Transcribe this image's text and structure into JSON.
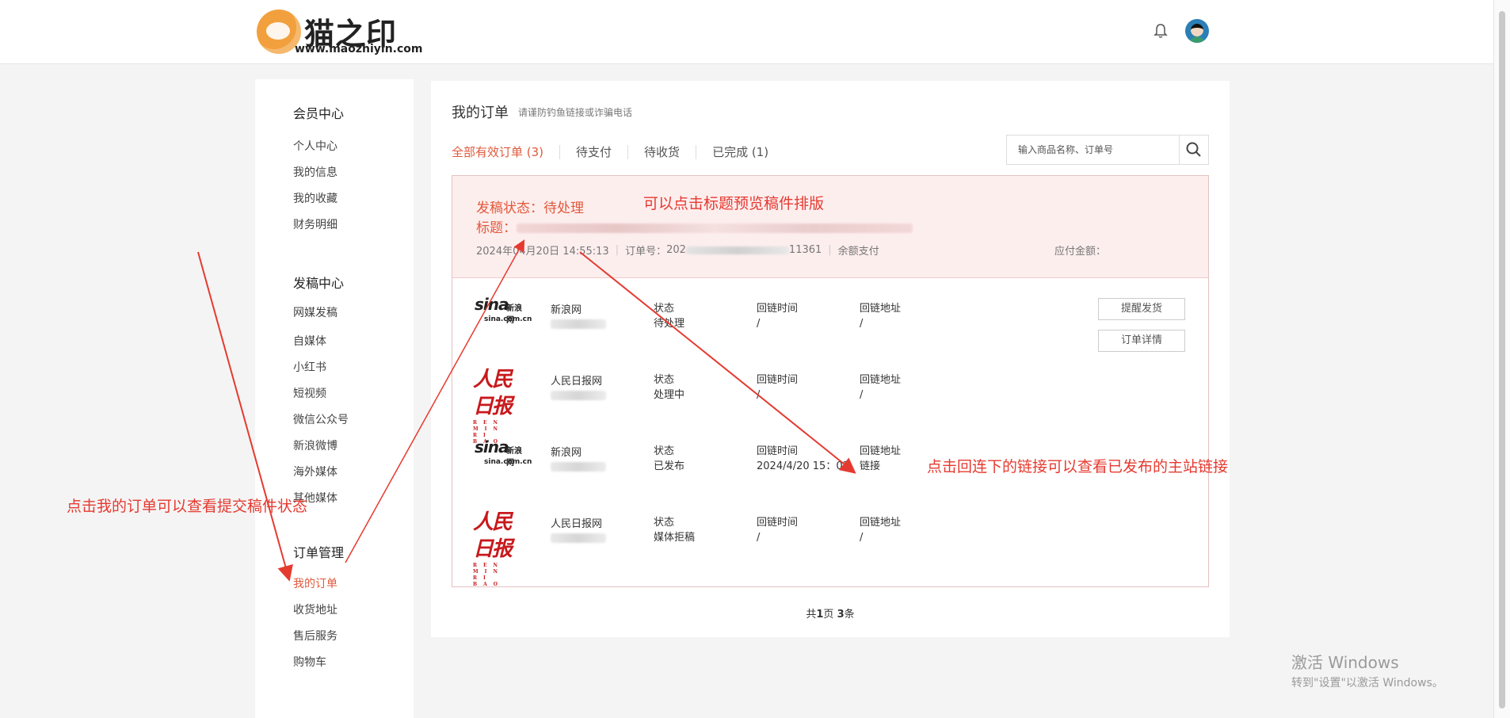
{
  "header": {
    "logo_name": "猫之印",
    "logo_url": "www.maozhiyin.com"
  },
  "sidebar": {
    "sections": [
      {
        "title": "会员中心",
        "items": [
          "个人中心",
          "我的信息",
          "我的收藏",
          "财务明细"
        ]
      },
      {
        "title": "发稿中心",
        "items": [
          "网媒发稿",
          "自媒体",
          "小红书",
          "短视频",
          "微信公众号",
          "新浪微博",
          "海外媒体",
          "其他媒体"
        ]
      },
      {
        "title": "订单管理",
        "items": [
          "我的订单",
          "收货地址",
          "售后服务",
          "购物车"
        ]
      }
    ],
    "active_item": "我的订单"
  },
  "main": {
    "title": "我的订单",
    "notice": "请谨防钓鱼链接或诈骗电话",
    "tabs": [
      "全部有效订单 (3)",
      "待支付",
      "待收货",
      "已完成 (1)"
    ],
    "search_placeholder": "输入商品名称、订单号",
    "order": {
      "status_line": "发稿状态：待处理",
      "title_label": "标题：",
      "date": "2024年04月20日 14:55:13",
      "order_no_label": "订单号：",
      "order_no_prefix": "202",
      "order_no_suffix": "11361",
      "payment": "余额支付",
      "payable_label": "应付金额："
    },
    "columns": {
      "status": "状态",
      "backlink_time": "回链时间",
      "backlink_url": "回链地址"
    },
    "rows": [
      {
        "logo": "sina",
        "media": "新浪网",
        "status": "待处理",
        "time": "/",
        "url": "/"
      },
      {
        "logo": "rmrb",
        "media": "人民日报网",
        "status": "处理中",
        "time": "/",
        "url": "/"
      },
      {
        "logo": "sina",
        "media": "新浪网",
        "status": "已发布",
        "time": "2024/4/20 15：02",
        "url": "链接"
      },
      {
        "logo": "rmrb",
        "media": "人民日报网",
        "status": "媒体拒稿",
        "time": "/",
        "url": "/"
      }
    ],
    "buttons": {
      "remind": "提醒发货",
      "detail": "订单详情"
    },
    "pager": {
      "prefix": "共",
      "pages": "1",
      "mid": "页 ",
      "count": "3",
      "suffix": "条"
    }
  },
  "logos": {
    "sina_word": "sina",
    "sina_cn": "新浪网",
    "sina_domain": "sina.com.cn",
    "rmrb_word": "人民日报",
    "rmrb_pinyin": "REN MIN RI BAO"
  },
  "annotations": {
    "note_preview": "可以点击标题预览稿件排版",
    "note_link": "点击回连下的链接可以查看已发布的主站链接",
    "note_orders": "点击我的订单可以查看提交稿件状态",
    "color": "#e53a30"
  },
  "watermark": {
    "line1": "激活 Windows",
    "line2": "转到\"设置\"以激活 Windows。"
  },
  "colors": {
    "accent": "#e0593c",
    "order_header_bg": "#fdeeee"
  }
}
